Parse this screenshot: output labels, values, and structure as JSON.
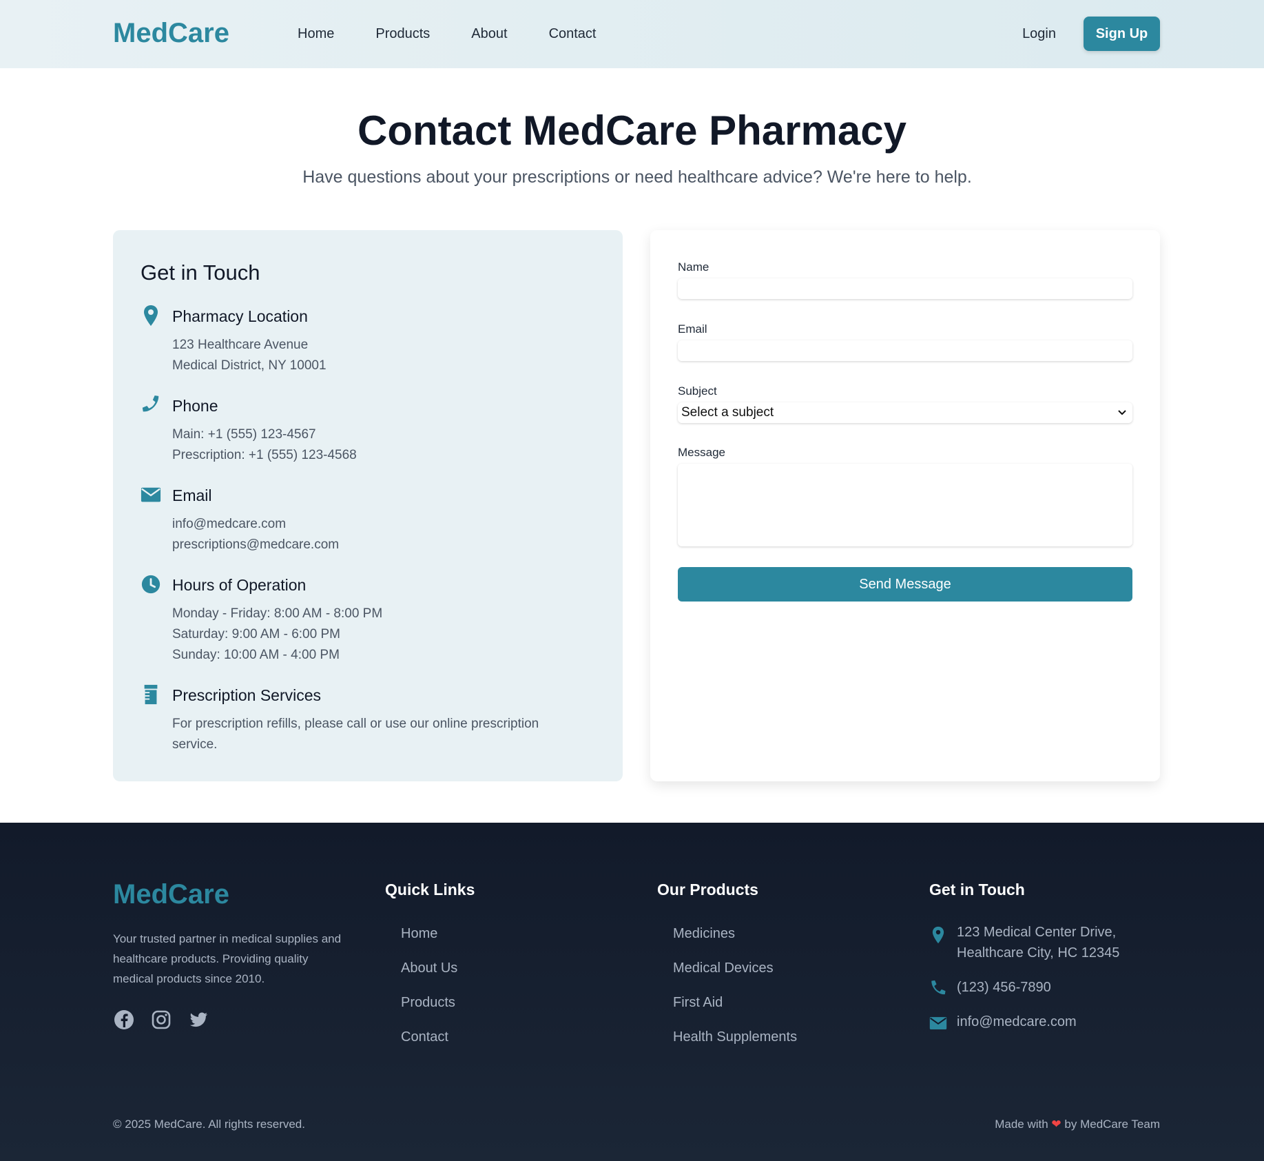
{
  "header": {
    "logo": "MedCare",
    "nav": [
      "Home",
      "Products",
      "About",
      "Contact"
    ],
    "login": "Login",
    "signup": "Sign Up"
  },
  "hero": {
    "title": "Contact MedCare Pharmacy",
    "subtitle": "Have questions about your prescriptions or need healthcare advice? We're here to help."
  },
  "info": {
    "heading": "Get in Touch",
    "items": [
      {
        "icon": "map-pin-icon",
        "title": "Pharmacy Location",
        "lines": [
          "123 Healthcare Avenue",
          "Medical District, NY 10001"
        ]
      },
      {
        "icon": "phone-icon",
        "title": "Phone",
        "lines": [
          "Main: +1 (555) 123-4567",
          "Prescription: +1 (555) 123-4568"
        ]
      },
      {
        "icon": "envelope-icon",
        "title": "Email",
        "lines": [
          "info@medcare.com",
          "prescriptions@medcare.com"
        ]
      },
      {
        "icon": "clock-icon",
        "title": "Hours of Operation",
        "lines": [
          "Monday - Friday: 8:00 AM - 8:00 PM",
          "Saturday: 9:00 AM - 6:00 PM",
          "Sunday: 10:00 AM - 4:00 PM"
        ]
      },
      {
        "icon": "prescription-bottle-icon",
        "title": "Prescription Services",
        "lines": [
          "For prescription refills, please call or use our online prescription",
          "service."
        ]
      }
    ]
  },
  "form": {
    "name_label": "Name",
    "email_label": "Email",
    "subject_label": "Subject",
    "subject_value": "Select a subject",
    "message_label": "Message",
    "submit": "Send Message"
  },
  "footer": {
    "logo": "MedCare",
    "description": "Your trusted partner in medical supplies and healthcare products. Providing quality medical products since 2010.",
    "quick_links": {
      "heading": "Quick Links",
      "links": [
        "Home",
        "About Us",
        "Products",
        "Contact"
      ]
    },
    "products": {
      "heading": "Our Products",
      "links": [
        "Medicines",
        "Medical Devices",
        "First Aid",
        "Health Supplements"
      ]
    },
    "contact": {
      "heading": "Get in Touch",
      "address_1": "123 Medical Center Drive,",
      "address_2": "Healthcare City, HC 12345",
      "phone": "(123) 456-7890",
      "email": "info@medcare.com"
    },
    "copyright": "© 2025 MedCare. All rights reserved.",
    "made_with_prefix": "Made with",
    "made_with_suffix": "by MedCare Team"
  },
  "colors": {
    "brand": "#2c889f",
    "footer_bg": "#121a2a",
    "card_bg": "#e8f1f4",
    "heart": "#ef4444"
  }
}
